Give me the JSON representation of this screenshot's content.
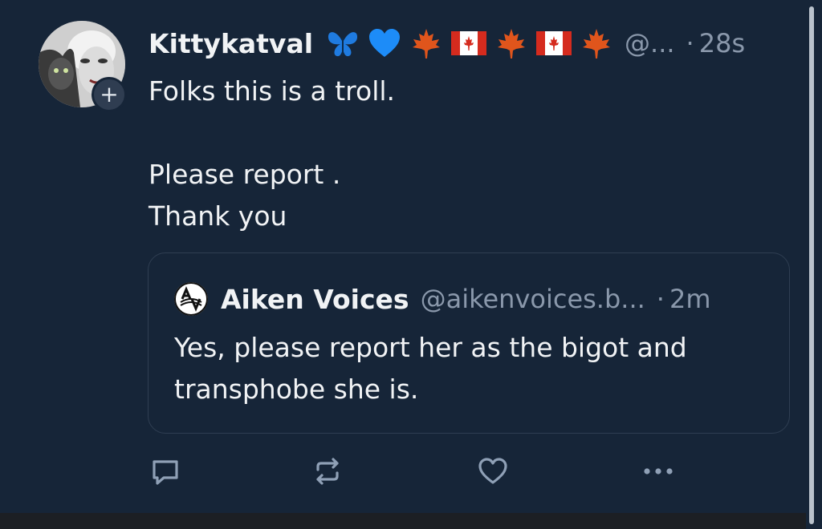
{
  "post": {
    "author": {
      "display_name": "Kittykatval",
      "handle": "@...",
      "badge_emojis": [
        "butterfly",
        "blue-heart",
        "maple-leaf",
        "canada-flag",
        "maple-leaf",
        "canada-flag",
        "maple-leaf"
      ]
    },
    "separator": "·",
    "time": "28s",
    "follow_symbol": "+",
    "text_lines": [
      "Folks this is a troll.",
      "",
      "Please report .",
      "Thank you"
    ]
  },
  "quote": {
    "display_name": "Aiken Voices",
    "handle": "@aikenvoices.b...",
    "separator": "·",
    "time": "2m",
    "text": "Yes, please report her as the bigot and transphobe she is."
  },
  "actions": [
    "reply-icon",
    "repost-icon",
    "like-icon",
    "more-icon"
  ],
  "colors": {
    "background": "#162538",
    "text": "#f1f3f5",
    "muted": "#8a98ab",
    "border": "#2f3e52",
    "heart_blue": "#1d8cf8",
    "butterfly_blue": "#1f7be0",
    "maple_orange": "#e0551c",
    "flag_red": "#d52b1e"
  }
}
